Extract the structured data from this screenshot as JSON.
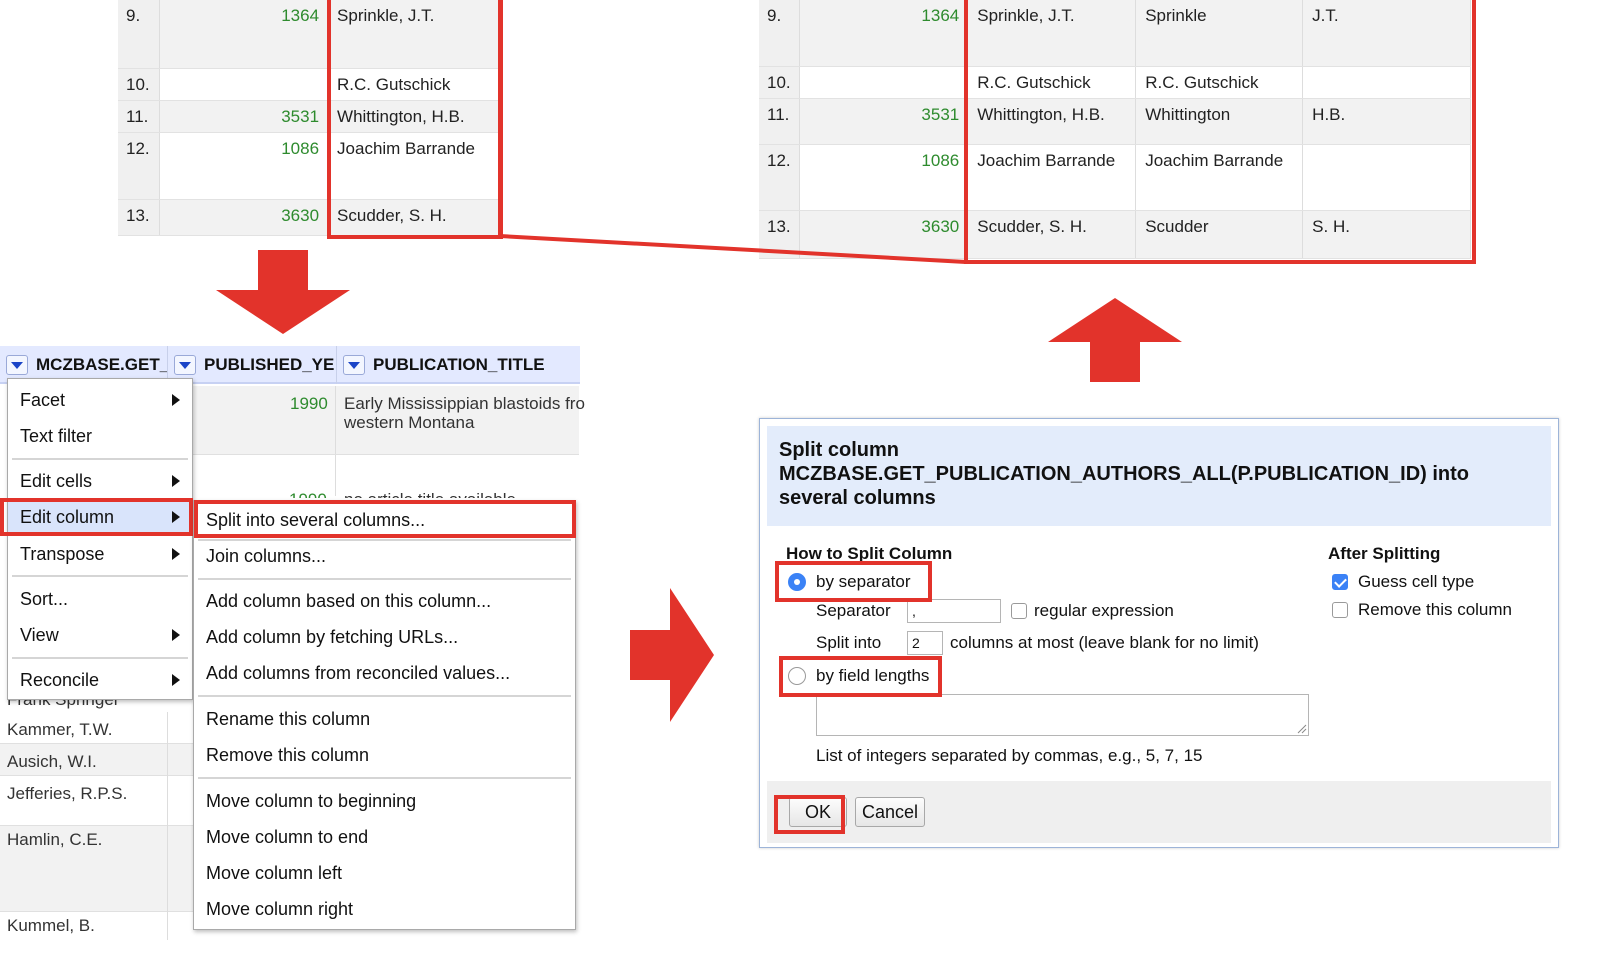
{
  "left_table": {
    "rows": [
      {
        "idx": "9.",
        "num": "1364",
        "author": "Sprinkle, J.T."
      },
      {
        "idx": "10.",
        "num": "",
        "author": "R.C. Gutschick"
      },
      {
        "idx": "11.",
        "num": "3531",
        "author": "Whittington, H.B."
      },
      {
        "idx": "12.",
        "num": "1086",
        "author": "Joachim Barrande"
      },
      {
        "idx": "13.",
        "num": "3630",
        "author": "Scudder, S. H."
      }
    ]
  },
  "right_table": {
    "rows": [
      {
        "idx": "9.",
        "num": "1364",
        "author": "Sprinkle, J.T.",
        "part1": "Sprinkle",
        "part2": "J.T."
      },
      {
        "idx": "10.",
        "num": "",
        "author": "R.C. Gutschick",
        "part1": "R.C. Gutschick",
        "part2": ""
      },
      {
        "idx": "11.",
        "num": "3531",
        "author": "Whittington, H.B.",
        "part1": "Whittington",
        "part2": "H.B."
      },
      {
        "idx": "12.",
        "num": "1086",
        "author": "Joachim Barrande",
        "part1": "Joachim Barrande",
        "part2": ""
      },
      {
        "idx": "13.",
        "num": "3630",
        "author": "Scudder, S. H.",
        "part1": "Scudder",
        "part2": "S. H."
      }
    ]
  },
  "column_headers": [
    "MCZBASE.GET_",
    "PUBLISHED_YE",
    "PUBLICATION_TITLE"
  ],
  "background_rows": {
    "year": "1990",
    "title_line1": "Early Mississippian blastoids fro",
    "title_line2": "western Montana",
    "partial_year": "1990",
    "partial_title": "no article title available",
    "partial_author": "Frank Springer",
    "authors": [
      "Kammer, T.W.",
      "Ausich, W.I.",
      "Jefferies, R.P.S.",
      "Hamlin, C.E.",
      "Kummel, B."
    ]
  },
  "column_menu": {
    "items": [
      {
        "label": "Facet",
        "submenu": true
      },
      {
        "label": "Text filter",
        "submenu": false
      },
      {
        "label": "Edit cells",
        "submenu": true
      },
      {
        "label": "Edit column",
        "submenu": true
      },
      {
        "label": "Transpose",
        "submenu": true
      },
      {
        "label": "Sort...",
        "submenu": false
      },
      {
        "label": "View",
        "submenu": true
      },
      {
        "label": "Reconcile",
        "submenu": true
      }
    ]
  },
  "edit_column_submenu": {
    "items": [
      "Split into several columns...",
      "Join columns...",
      "Add column based on this column...",
      "Add column by fetching URLs...",
      "Add columns from reconciled values...",
      "Rename this column",
      "Remove this column",
      "Move column to beginning",
      "Move column to end",
      "Move column left",
      "Move column right"
    ]
  },
  "dialog": {
    "title": "Split column MCZBASE.GET_PUBLICATION_AUTHORS_ALL(P.PUBLICATION_ID) into several columns",
    "how_heading": "How to Split Column",
    "by_separator": "by separator",
    "separator_label": "Separator",
    "separator_value": ",",
    "regex_label": "regular expression",
    "split_into_label": "Split into",
    "split_into_value": "2",
    "columns_at_most": "columns at most (leave blank for no limit)",
    "by_field_lengths": "by field lengths",
    "field_lengths_value": "",
    "field_lengths_hint": "List of integers separated by commas, e.g., 5, 7, 15",
    "after_heading": "After Splitting",
    "guess_cell_type": "Guess cell type",
    "remove_this_column": "Remove this column",
    "ok": "OK",
    "cancel": "Cancel"
  },
  "colors": {
    "highlight_red": "#e2332b",
    "number_green": "#2e8b2e",
    "header_blue": "#e3e9ff",
    "dialog_header": "#e3ecfb",
    "radio_blue": "#3b82f6"
  }
}
